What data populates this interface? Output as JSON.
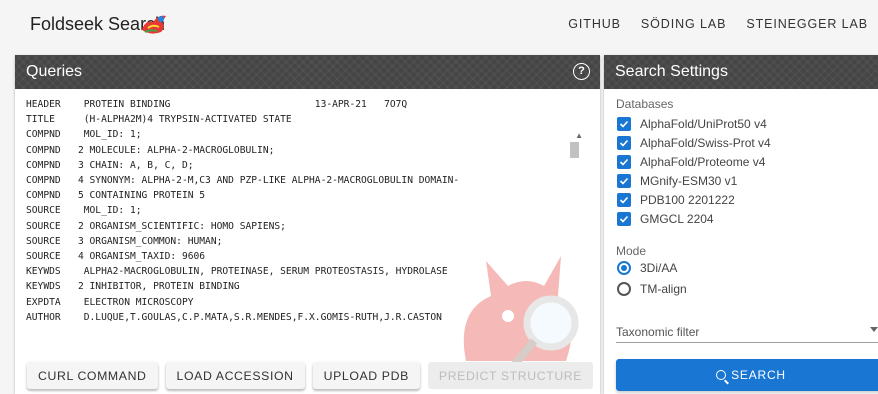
{
  "app": {
    "title": "Foldseek Search"
  },
  "nav": {
    "links": [
      "GITHUB",
      "SÖDING LAB",
      "STEINEGGER LAB"
    ]
  },
  "queries": {
    "title": "Queries",
    "help_icon": "help-circle-icon",
    "text": "HEADER    PROTEIN BINDING                         13-APR-21   7O7Q\nTITLE     (H-ALPHA2M)4 TRYPSIN-ACTIVATED STATE\nCOMPND    MOL_ID: 1;\nCOMPND   2 MOLECULE: ALPHA-2-MACROGLOBULIN;\nCOMPND   3 CHAIN: A, B, C, D;\nCOMPND   4 SYNONYM: ALPHA-2-M,C3 AND PZP-LIKE ALPHA-2-MACROGLOBULIN DOMAIN-\nCOMPND   5 CONTAINING PROTEIN 5\nSOURCE    MOL_ID: 1;\nSOURCE   2 ORGANISM_SCIENTIFIC: HOMO SAPIENS;\nSOURCE   3 ORGANISM_COMMON: HUMAN;\nSOURCE   4 ORGANISM_TAXID: 9606\nKEYWDS    ALPHA2-MACROGLOBULIN, PROTEINASE, SERUM PROTEOSTASIS, HYDROLASE\nKEYWDS   2 INHIBITOR, PROTEIN BINDING\nEXPDTA    ELECTRON MICROSCOPY\nAUTHOR    D.LUQUE,T.GOULAS,C.P.MATA,S.R.MENDES,F.X.GOMIS-RUTH,J.R.CASTON",
    "buttons": {
      "curl": "CURL COMMAND",
      "load": "LOAD ACCESSION",
      "upload": "UPLOAD PDB",
      "predict": "PREDICT STRUCTURE"
    }
  },
  "settings": {
    "title": "Search Settings",
    "databases_label": "Databases",
    "databases": [
      {
        "label": "AlphaFold/UniProt50 v4",
        "checked": true
      },
      {
        "label": "AlphaFold/Swiss-Prot v4",
        "checked": true
      },
      {
        "label": "AlphaFold/Proteome v4",
        "checked": true
      },
      {
        "label": "MGnify-ESM30 v1",
        "checked": true
      },
      {
        "label": "PDB100 2201222",
        "checked": true
      },
      {
        "label": "GMGCL 2204",
        "checked": true
      }
    ],
    "mode_label": "Mode",
    "modes": [
      {
        "label": "3Di/AA",
        "selected": true
      },
      {
        "label": "TM-align",
        "selected": false
      }
    ],
    "taxonomic_filter_label": "Taxonomic filter",
    "search_label": "SEARCH"
  },
  "colors": {
    "primary": "#1976d2",
    "header_bg": "#454545"
  }
}
